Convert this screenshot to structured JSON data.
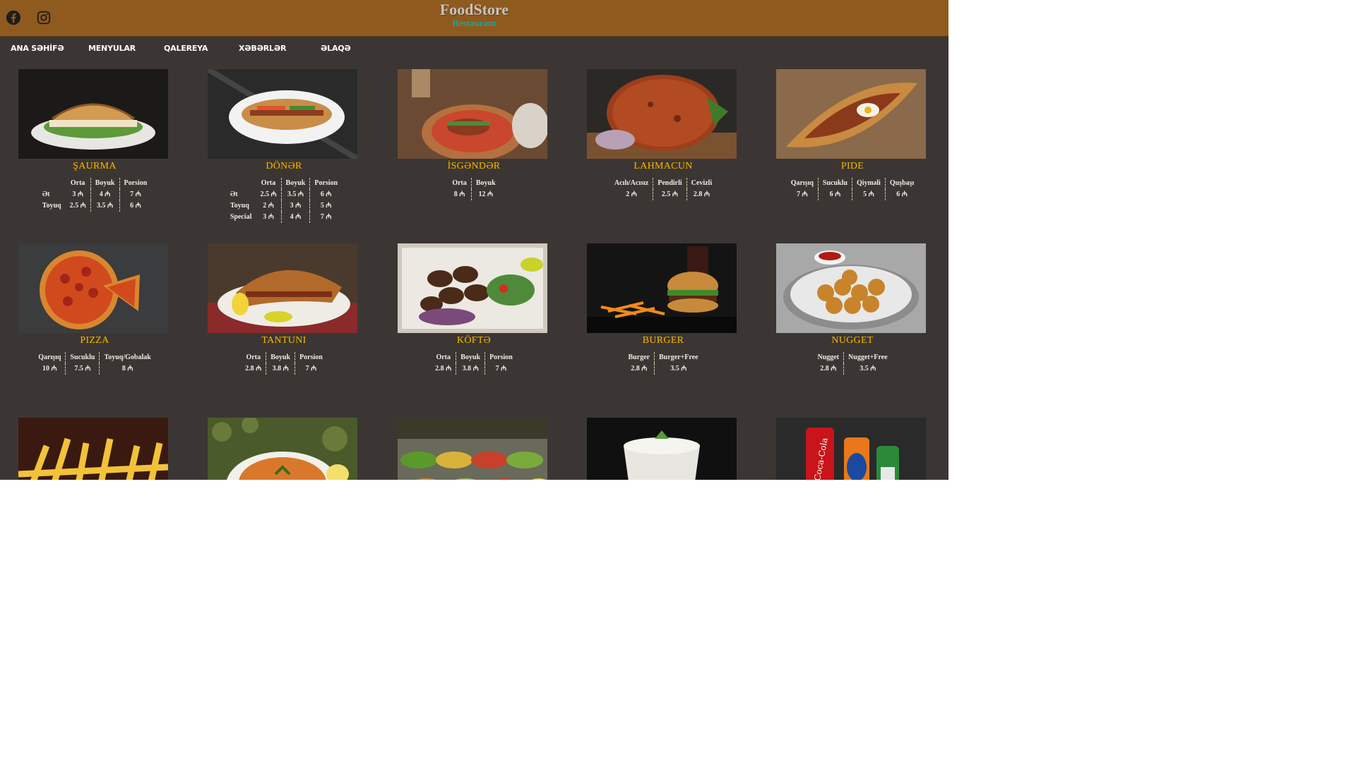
{
  "header": {
    "title": "FoodStore",
    "subtitle": "Restaurant",
    "social": [
      {
        "icon": "facebook-icon"
      },
      {
        "icon": "instagram-icon"
      }
    ],
    "colors": {
      "bar": "#8f5a1e",
      "page": "#3b3634",
      "accent": "#f2b400",
      "subtitle": "#1fa49a"
    }
  },
  "nav": {
    "items": [
      "ANA SƏHİFƏ",
      "MENYULAR",
      "QALEREYA",
      "XƏBƏRLƏR",
      "ƏLAQƏ"
    ]
  },
  "menu": [
    {
      "name": "ŞAURMA",
      "columns": [
        "",
        "Orta",
        "Boyuk",
        "Porsion"
      ],
      "rows": [
        [
          "Ət",
          "3 ₼",
          "4 ₼",
          "7 ₼"
        ],
        [
          "Toyuq",
          "2.5 ₼",
          "3.5 ₼",
          "6 ₼"
        ]
      ]
    },
    {
      "name": "DÖNƏR",
      "columns": [
        "",
        "Orta",
        "Boyuk",
        "Porsion"
      ],
      "rows": [
        [
          "Ət",
          "2.5 ₼",
          "3.5 ₼",
          "6 ₼"
        ],
        [
          "Toyuq",
          "2 ₼",
          "3 ₼",
          "5 ₼"
        ],
        [
          "Special",
          "3 ₼",
          "4 ₼",
          "7 ₼"
        ]
      ]
    },
    {
      "name": "İSGƏNDƏR",
      "columns": [
        "Orta",
        "Boyuk"
      ],
      "rows": [
        [
          "8 ₼",
          "12 ₼"
        ]
      ]
    },
    {
      "name": "LAHMACUN",
      "columns": [
        "Acılı/Acısız",
        "Pendirli",
        "Cevizli"
      ],
      "rows": [
        [
          "2 ₼",
          "2.5 ₼",
          "2.8 ₼"
        ]
      ]
    },
    {
      "name": "PIDE",
      "columns": [
        "Qarışıq",
        "Sucuklu",
        "Qiyməli",
        "Quşbaşı"
      ],
      "rows": [
        [
          "7 ₼",
          "6 ₼",
          "5 ₼",
          "6 ₼"
        ]
      ]
    },
    {
      "name": "PIZZA",
      "columns": [
        "Qarışıq",
        "Sucuklu",
        "Toyuq/Gobalak"
      ],
      "rows": [
        [
          "10 ₼",
          "7.5 ₼",
          "8 ₼"
        ]
      ]
    },
    {
      "name": "TANTUNI",
      "columns": [
        "Orta",
        "Boyuk",
        "Porsion"
      ],
      "rows": [
        [
          "2.8 ₼",
          "3.8 ₼",
          "7 ₼"
        ]
      ]
    },
    {
      "name": "KÖFTƏ",
      "columns": [
        "Orta",
        "Boyuk",
        "Porsion"
      ],
      "rows": [
        [
          "2.8 ₼",
          "3.8 ₼",
          "7 ₼"
        ]
      ]
    },
    {
      "name": "BURGER",
      "columns": [
        "Burger",
        "Burger+Free"
      ],
      "rows": [
        [
          "2.8 ₼",
          "3.5 ₼"
        ]
      ]
    },
    {
      "name": "NUGGET",
      "columns": [
        "Nugget",
        "Nugget+Free"
      ],
      "rows": [
        [
          "2.8 ₼",
          "3.5 ₼"
        ]
      ]
    },
    {
      "name": "",
      "columns": [],
      "rows": []
    },
    {
      "name": "",
      "columns": [],
      "rows": []
    },
    {
      "name": "",
      "columns": [],
      "rows": []
    },
    {
      "name": "",
      "columns": [],
      "rows": []
    },
    {
      "name": "",
      "columns": [],
      "rows": []
    }
  ]
}
